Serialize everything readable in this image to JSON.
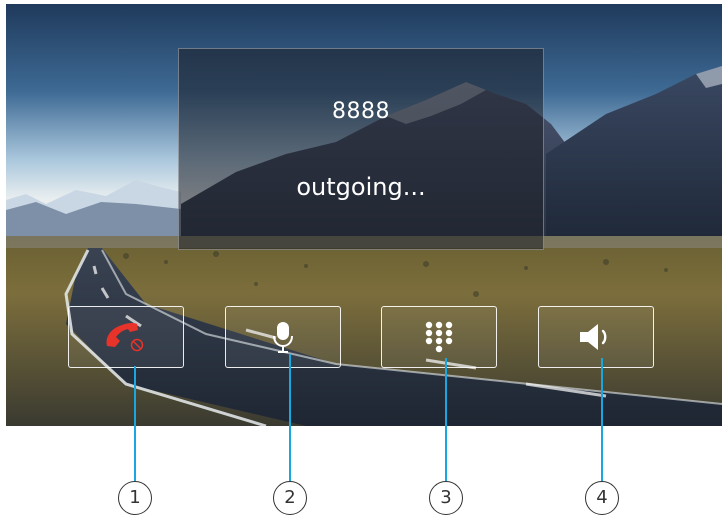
{
  "call": {
    "number": "8888",
    "status": "outgoing..."
  },
  "controls": [
    {
      "name": "hang-up",
      "icon": "hang-up-phone-icon",
      "color": "#e8332b"
    },
    {
      "name": "microphone",
      "icon": "microphone-icon",
      "color": "#ffffff"
    },
    {
      "name": "keypad",
      "icon": "keypad-grid-icon",
      "color": "#ffffff"
    },
    {
      "name": "speaker",
      "icon": "speaker-volume-icon",
      "color": "#ffffff"
    }
  ],
  "callouts": [
    "1",
    "2",
    "3",
    "4"
  ],
  "colors": {
    "callout_line": "#1aa7e0",
    "panel_border": "#ffffff",
    "hangup_red": "#e8332b"
  }
}
